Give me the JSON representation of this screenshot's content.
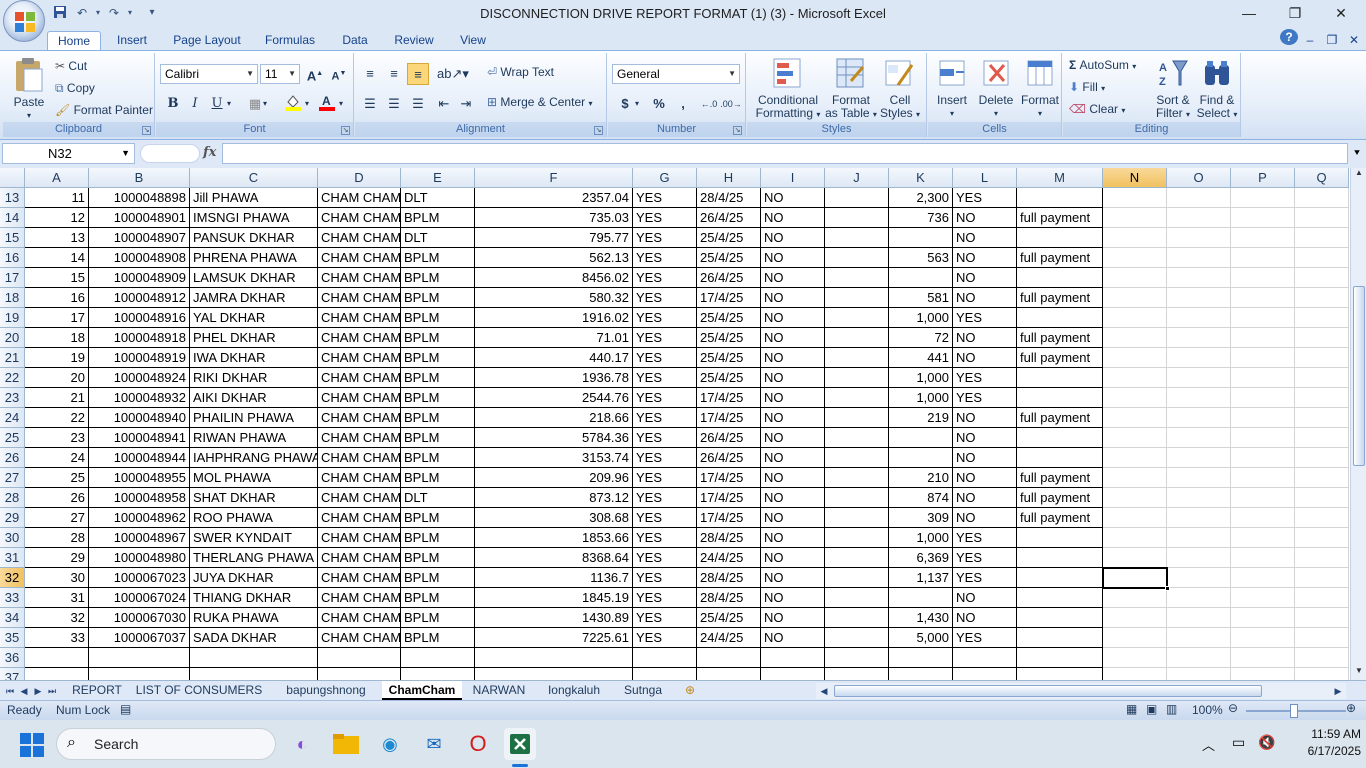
{
  "window": {
    "title": "DISCONNECTION DRIVE REPORT FORMAT (1) (3)  -  Microsoft Excel",
    "minimize": "—",
    "restore": "❐",
    "close": "✕"
  },
  "ribbon_tabs": [
    "Home",
    "Insert",
    "Page Layout",
    "Formulas",
    "Data",
    "Review",
    "View"
  ],
  "ribbon": {
    "clipboard": {
      "label": "Clipboard",
      "paste": "Paste",
      "cut": "Cut",
      "copy": "Copy",
      "format_painter": "Format Painter"
    },
    "font": {
      "label": "Font",
      "font_name": "Calibri",
      "font_size": "11",
      "bold": "B",
      "italic": "I",
      "underline": "U"
    },
    "alignment": {
      "label": "Alignment",
      "wrap_text": "Wrap Text",
      "merge_center": "Merge & Center"
    },
    "number": {
      "label": "Number",
      "format": "General",
      "currency": "$",
      "percent": "%",
      "comma": ","
    },
    "styles": {
      "label": "Styles",
      "conditional_1": "Conditional",
      "conditional_2": "Formatting",
      "format_table_1": "Format",
      "format_table_2": "as Table",
      "cell_styles_1": "Cell",
      "cell_styles_2": "Styles"
    },
    "cells": {
      "label": "Cells",
      "insert": "Insert",
      "delete": "Delete",
      "format": "Format"
    },
    "editing": {
      "label": "Editing",
      "autosum": "AutoSum",
      "fill": "Fill",
      "clear": "Clear",
      "sort_1": "Sort &",
      "sort_2": "Filter",
      "find_1": "Find &",
      "find_2": "Select"
    }
  },
  "formula_bar": {
    "name_box": "N32",
    "fx": "fx",
    "formula": ""
  },
  "columns": [
    "A",
    "B",
    "C",
    "D",
    "E",
    "F",
    "G",
    "H",
    "I",
    "J",
    "K",
    "L",
    "M",
    "N",
    "O",
    "P",
    "Q"
  ],
  "selected_column": "N",
  "selected_row": "32",
  "rows": [
    {
      "n": "13",
      "c": [
        "11",
        "1000048898",
        "Jill PHAWA",
        "CHAM CHAM",
        "DLT",
        "2357.04",
        "YES",
        "28/4/25",
        "NO",
        "",
        "2,300",
        "YES",
        ""
      ]
    },
    {
      "n": "14",
      "c": [
        "12",
        "1000048901",
        "IMSNGI PHAWA",
        "CHAM CHAM",
        "BPLM",
        "735.03",
        "YES",
        "26/4/25",
        "NO",
        "",
        "736",
        "NO",
        "full payment"
      ]
    },
    {
      "n": "15",
      "c": [
        "13",
        "1000048907",
        "PANSUK DKHAR",
        "CHAM CHAM",
        "DLT",
        "795.77",
        "YES",
        "25/4/25",
        "NO",
        "",
        "",
        "NO",
        ""
      ]
    },
    {
      "n": "16",
      "c": [
        "14",
        "1000048908",
        "PHRENA PHAWA",
        "CHAM CHAM",
        "BPLM",
        "562.13",
        "YES",
        "25/4/25",
        "NO",
        "",
        "563",
        "NO",
        "full payment"
      ]
    },
    {
      "n": "17",
      "c": [
        "15",
        "1000048909",
        "LAMSUK DKHAR",
        "CHAM CHAM",
        "BPLM",
        "8456.02",
        "YES",
        "26/4/25",
        "NO",
        "",
        "",
        "NO",
        ""
      ]
    },
    {
      "n": "18",
      "c": [
        "16",
        "1000048912",
        "JAMRA DKHAR",
        "CHAM CHAM",
        "BPLM",
        "580.32",
        "YES",
        "17/4/25",
        "NO",
        "",
        "581",
        "NO",
        "full payment"
      ]
    },
    {
      "n": "19",
      "c": [
        "17",
        "1000048916",
        "YAL DKHAR",
        "CHAM CHAM",
        "BPLM",
        "1916.02",
        "YES",
        "25/4/25",
        "NO",
        "",
        "1,000",
        "YES",
        ""
      ]
    },
    {
      "n": "20",
      "c": [
        "18",
        "1000048918",
        "PHEL  DKHAR",
        "CHAM CHAM",
        "BPLM",
        "71.01",
        "YES",
        "25/4/25",
        "NO",
        "",
        "72",
        "NO",
        "full payment"
      ]
    },
    {
      "n": "21",
      "c": [
        "19",
        "1000048919",
        "IWA DKHAR",
        "CHAM CHAM",
        "BPLM",
        "440.17",
        "YES",
        "25/4/25",
        "NO",
        "",
        "441",
        "NO",
        "full payment"
      ]
    },
    {
      "n": "22",
      "c": [
        "20",
        "1000048924",
        "RIKI DKHAR",
        "CHAM CHAM",
        "BPLM",
        "1936.78",
        "YES",
        "25/4/25",
        "NO",
        "",
        "1,000",
        "YES",
        ""
      ]
    },
    {
      "n": "23",
      "c": [
        "21",
        "1000048932",
        "AIKI DKHAR",
        "CHAM CHAM",
        "BPLM",
        "2544.76",
        "YES",
        "17/4/25",
        "NO",
        "",
        "1,000",
        "YES",
        ""
      ]
    },
    {
      "n": "24",
      "c": [
        "22",
        "1000048940",
        "PHAILIN PHAWA",
        "CHAM CHAM",
        "BPLM",
        "218.66",
        "YES",
        "17/4/25",
        "NO",
        "",
        "219",
        "NO",
        "full payment"
      ]
    },
    {
      "n": "25",
      "c": [
        "23",
        "1000048941",
        "RIWAN PHAWA",
        "CHAM CHAM",
        "BPLM",
        "5784.36",
        "YES",
        "26/4/25",
        "NO",
        "",
        "",
        "NO",
        ""
      ]
    },
    {
      "n": "26",
      "c": [
        "24",
        "1000048944",
        "IAHPHRANG PHAWA",
        "CHAM CHAM",
        "BPLM",
        "3153.74",
        "YES",
        "26/4/25",
        "NO",
        "",
        "",
        "NO",
        ""
      ]
    },
    {
      "n": "27",
      "c": [
        "25",
        "1000048955",
        "MOL PHAWA",
        "CHAM CHAM",
        "BPLM",
        "209.96",
        "YES",
        "17/4/25",
        "NO",
        "",
        "210",
        "NO",
        "full payment"
      ]
    },
    {
      "n": "28",
      "c": [
        "26",
        "1000048958",
        "SHAT DKHAR",
        "CHAM CHAM",
        "DLT",
        "873.12",
        "YES",
        "17/4/25",
        "NO",
        "",
        "874",
        "NO",
        "full payment"
      ]
    },
    {
      "n": "29",
      "c": [
        "27",
        "1000048962",
        "ROO PHAWA",
        "CHAM CHAM",
        "BPLM",
        "308.68",
        "YES",
        "17/4/25",
        "NO",
        "",
        "309",
        "NO",
        "full payment"
      ]
    },
    {
      "n": "30",
      "c": [
        "28",
        "1000048967",
        "SWER KYNDAIT",
        "CHAM CHAM",
        "BPLM",
        "1853.66",
        "YES",
        "28/4/25",
        "NO",
        "",
        "1,000",
        "YES",
        ""
      ]
    },
    {
      "n": "31",
      "c": [
        "29",
        "1000048980",
        "THERLANG PHAWA",
        "CHAM CHAM",
        "BPLM",
        "8368.64",
        "YES",
        "24/4/25",
        "NO",
        "",
        "6,369",
        "YES",
        ""
      ]
    },
    {
      "n": "32",
      "c": [
        "30",
        "1000067023",
        "JUYA DKHAR",
        "CHAM CHAM",
        "BPLM",
        "1136.7",
        "YES",
        "28/4/25",
        "NO",
        "",
        "1,137",
        "YES",
        ""
      ]
    },
    {
      "n": "33",
      "c": [
        "31",
        "1000067024",
        "THIANG DKHAR",
        "CHAM CHAM",
        "BPLM",
        "1845.19",
        "YES",
        "28/4/25",
        "NO",
        "",
        "",
        "NO",
        ""
      ]
    },
    {
      "n": "34",
      "c": [
        "32",
        "1000067030",
        "RUKA PHAWA",
        "CHAM CHAM",
        "BPLM",
        "1430.89",
        "YES",
        "25/4/25",
        "NO",
        "",
        "1,430",
        "NO",
        ""
      ]
    },
    {
      "n": "35",
      "c": [
        "33",
        "1000067037",
        "SADA DKHAR",
        "CHAM CHAM",
        "BPLM",
        "7225.61",
        "YES",
        "24/4/25",
        "NO",
        "",
        "5,000",
        "YES",
        ""
      ]
    },
    {
      "n": "36",
      "c": [
        "",
        "",
        "",
        "",
        "",
        "",
        "",
        "",
        "",
        "",
        "",
        "",
        ""
      ]
    },
    {
      "n": "37",
      "c": [
        "",
        "",
        "",
        "",
        "",
        "",
        "",
        "",
        "",
        "",
        "",
        "",
        ""
      ]
    }
  ],
  "sheet_tabs": [
    "REPORT",
    "LIST OF CONSUMERS",
    "bapungshnong",
    "ChamCham",
    "NARWAN",
    "Iongkaluh",
    "Sutnga"
  ],
  "active_sheet": "ChamCham",
  "status": {
    "ready": "Ready",
    "num_lock": "Num Lock",
    "zoom": "100%"
  },
  "taskbar": {
    "search": "Search",
    "time": "11:59 AM",
    "date": "6/17/2025"
  }
}
